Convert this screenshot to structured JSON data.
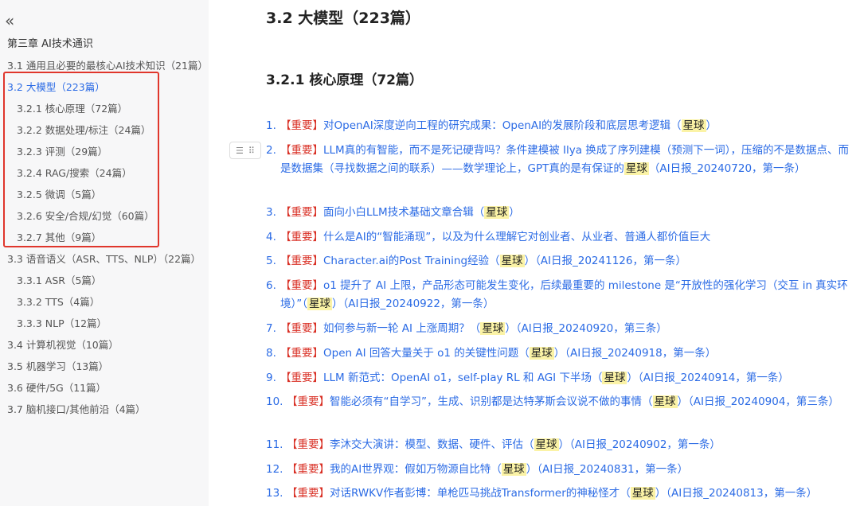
{
  "sidebar": {
    "collapse_glyph": "«",
    "chapter": "第三章 AI技术通识",
    "items": [
      {
        "label": "3.1 通用且必要的最核心AI技术知识（21篇）"
      },
      {
        "label": "3.2 大模型（223篇）"
      },
      {
        "label": "3.2.1 核心原理（72篇）"
      },
      {
        "label": "3.2.2 数据处理/标注（24篇）"
      },
      {
        "label": "3.2.3 评测（29篇）"
      },
      {
        "label": "3.2.4 RAG/搜索（24篇）"
      },
      {
        "label": "3.2.5 微调（5篇）"
      },
      {
        "label": "3.2.6 安全/合规/幻觉（60篇）"
      },
      {
        "label": "3.2.7 其他（9篇）"
      },
      {
        "label": "3.3 语音语义（ASR、TTS、NLP）（22篇）"
      },
      {
        "label": "3.3.1 ASR（5篇）"
      },
      {
        "label": "3.3.2 TTS（4篇）"
      },
      {
        "label": "3.3.3 NLP（12篇）"
      },
      {
        "label": "3.4 计算机视觉（10篇）"
      },
      {
        "label": "3.5 机器学习（13篇）"
      },
      {
        "label": "3.6 硬件/5G（11篇）"
      },
      {
        "label": "3.7 脑机接口/其他前沿（4篇）"
      }
    ]
  },
  "main": {
    "title": "3.2 大模型（223篇）",
    "subtitle": "3.2.1 核心原理（72篇）",
    "block_handle": {
      "list_glyph": "☰",
      "drag_glyph": "⠿"
    },
    "items": [
      {
        "num": "1.",
        "tag": "【重要】",
        "text": "对OpenAI深度逆向工程的研究成果：OpenAI的发展阶段和底层思考逻辑（",
        "star": "星球",
        "tail": "）"
      },
      {
        "num": "2.",
        "tag": "【重要】",
        "text": "LLM真的有智能，而不是死记硬背吗？条件建模被 Ilya 换成了序列建模（预测下一词），压缩的不是数据点、而是数据集（寻找数据之间的联系）——数学理论上，GPT真的是有保证的",
        "star": "星球",
        "tail": "（AI日报_20240720，第一条）"
      },
      {
        "num": "3.",
        "tag": "【重要】",
        "text": "面向小白LLM技术基础文章合辑（",
        "star": "星球",
        "tail": "）"
      },
      {
        "num": "4.",
        "tag": "【重要】",
        "text": "什么是AI的“智能涌现”，以及为什么理解它对创业者、从业者、普通人都价值巨大",
        "star": "",
        "tail": ""
      },
      {
        "num": "5.",
        "tag": "【重要】",
        "text": "Character.ai的Post Training经验（",
        "star": "星球",
        "tail": "）（AI日报_20241126，第一条）"
      },
      {
        "num": "6.",
        "tag": "【重要】",
        "text": "o1 提升了 AI 上限，产品形态可能发生变化，后续最重要的 milestone 是“开放性的强化学习（交互 in 真实环境）”（",
        "star": "星球",
        "tail": "）（AI日报_20240922，第一条）"
      },
      {
        "num": "7.",
        "tag": "【重要】",
        "text": "如何参与新一轮 AI 上涨周期？（",
        "star": "星球",
        "tail": "）（AI日报_20240920，第三条）"
      },
      {
        "num": "8.",
        "tag": "【重要】",
        "text": "Open AI 回答大量关于 o1 的关键性问题（",
        "star": "星球",
        "tail": "）（AI日报_20240918，第一条）"
      },
      {
        "num": "9.",
        "tag": "【重要】",
        "text": "LLM 新范式：OpenAI o1，self-play RL 和 AGI 下半场（",
        "star": "星球",
        "tail": "）（AI日报_20240914，第一条）"
      },
      {
        "num": "10.",
        "tag": "【重要】",
        "text": "智能必须有“自学习”，生成、识别都是达特茅斯会议说不做的事情（",
        "star": "星球",
        "tail": "）（AI日报_20240904，第三条）"
      },
      {
        "num": "11.",
        "tag": "【重要】",
        "text": "李沐交大演讲：模型、数据、硬件、评估（",
        "star": "星球",
        "tail": "）（AI日报_20240902，第一条）"
      },
      {
        "num": "12.",
        "tag": "【重要】",
        "text": "我的AI世界观：假如万物源自比特（",
        "star": "星球",
        "tail": "）（AI日报_20240831，第一条）"
      },
      {
        "num": "13.",
        "tag": "【重要】",
        "text": "对话RWKV作者彭博：单枪匹马挑战Transformer的神秘怪才（",
        "star": "星球",
        "tail": "）（AI日报_20240813，第一条）"
      }
    ]
  }
}
